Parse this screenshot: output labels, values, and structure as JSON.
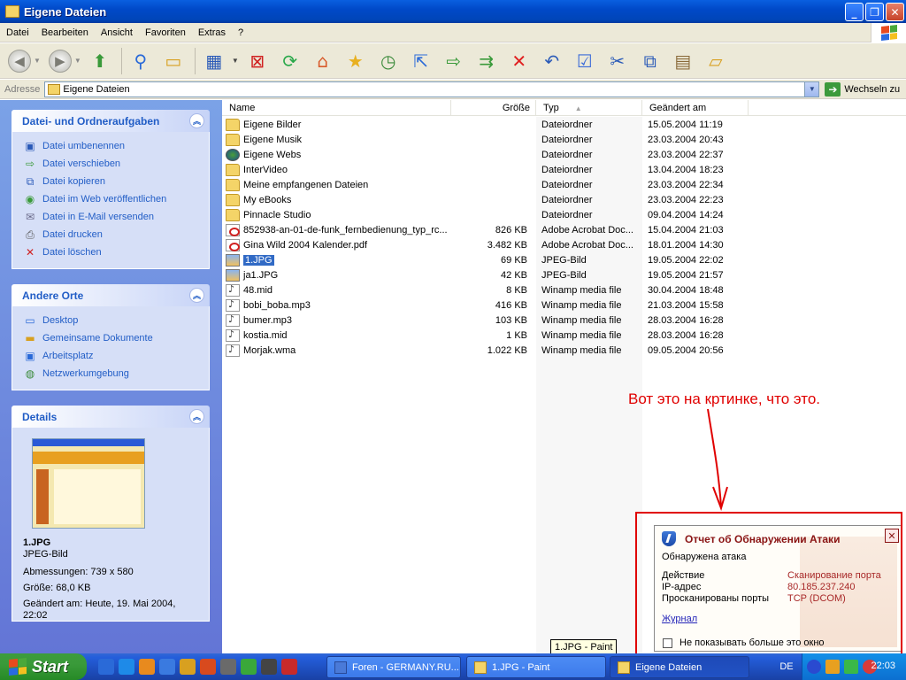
{
  "window": {
    "title": "Eigene Dateien"
  },
  "caption_buttons": {
    "minimize": "_",
    "maximize": "❐",
    "close": "✕"
  },
  "menu": [
    "Datei",
    "Bearbeiten",
    "Ansicht",
    "Favoriten",
    "Extras",
    "?"
  ],
  "toolbar": {
    "icons": [
      "back-icon",
      "forward-icon",
      "up-folder-icon",
      "search-icon",
      "folders-icon",
      "views-icon",
      "delete-file-icon",
      "refresh-icon",
      "home-icon",
      "favorites-star-icon",
      "history-icon",
      "map-drive-icon",
      "move-to-icon",
      "copy-to-icon",
      "delete-icon",
      "undo-icon",
      "properties-icon",
      "cut-icon",
      "copy-icon",
      "paste-icon",
      "folder-options-icon"
    ]
  },
  "address": {
    "label": "Adresse",
    "value": "Eigene Dateien",
    "go_label": "Wechseln zu"
  },
  "taskpane": {
    "file_tasks": {
      "title": "Datei- und Ordneraufgaben",
      "items": [
        {
          "label": "Datei umbenennen",
          "icon": "rename-icon"
        },
        {
          "label": "Datei verschieben",
          "icon": "move-icon"
        },
        {
          "label": "Datei kopieren",
          "icon": "copy-icon"
        },
        {
          "label": "Datei im Web veröffentlichen",
          "icon": "publish-web-icon"
        },
        {
          "label": "Datei in E-Mail versenden",
          "icon": "email-icon"
        },
        {
          "label": "Datei drucken",
          "icon": "print-icon"
        },
        {
          "label": "Datei löschen",
          "icon": "delete-icon"
        }
      ]
    },
    "other_places": {
      "title": "Andere Orte",
      "items": [
        {
          "label": "Desktop",
          "icon": "desktop-icon"
        },
        {
          "label": "Gemeinsame Dokumente",
          "icon": "shared-docs-icon"
        },
        {
          "label": "Arbeitsplatz",
          "icon": "my-computer-icon"
        },
        {
          "label": "Netzwerkumgebung",
          "icon": "network-icon"
        }
      ]
    },
    "details": {
      "title": "Details",
      "name": "1.JPG",
      "type": "JPEG-Bild",
      "dimensions": "Abmessungen: 739 x 580",
      "size": "Größe: 68,0 KB",
      "modified": "Geändert am: Heute, 19. Mai 2004, 22:02"
    }
  },
  "filelist": {
    "columns": {
      "name": "Name",
      "size": "Größe",
      "type": "Typ",
      "modified": "Geändert am"
    },
    "sort_arrow": "▲",
    "rows": [
      {
        "icon": "folder",
        "name": "Eigene Bilder",
        "size": "",
        "type": "Dateiordner",
        "modified": "15.05.2004 11:19"
      },
      {
        "icon": "folder",
        "name": "Eigene Musik",
        "size": "",
        "type": "Dateiordner",
        "modified": "23.03.2004 20:43"
      },
      {
        "icon": "web",
        "name": "Eigene Webs",
        "size": "",
        "type": "Dateiordner",
        "modified": "23.03.2004 22:37"
      },
      {
        "icon": "folder",
        "name": "InterVideo",
        "size": "",
        "type": "Dateiordner",
        "modified": "13.04.2004 18:23"
      },
      {
        "icon": "folder",
        "name": "Meine empfangenen Dateien",
        "size": "",
        "type": "Dateiordner",
        "modified": "23.03.2004 22:34"
      },
      {
        "icon": "folder",
        "name": "My eBooks",
        "size": "",
        "type": "Dateiordner",
        "modified": "23.03.2004 22:23"
      },
      {
        "icon": "folder",
        "name": "Pinnacle Studio",
        "size": "",
        "type": "Dateiordner",
        "modified": "09.04.2004 14:24"
      },
      {
        "icon": "pdf",
        "name": "852938-an-01-de-funk_fernbedienung_typ_rc...",
        "size": "826 KB",
        "type": "Adobe Acrobat Doc...",
        "modified": "15.04.2004 21:03"
      },
      {
        "icon": "pdf",
        "name": "Gina Wild 2004 Kalender.pdf",
        "size": "3.482 KB",
        "type": "Adobe Acrobat Doc...",
        "modified": "18.01.2004 14:30"
      },
      {
        "icon": "jpg",
        "name": "1.JPG",
        "size": "69 KB",
        "type": "JPEG-Bild",
        "modified": "19.05.2004 22:02",
        "selected": true
      },
      {
        "icon": "jpg",
        "name": "ja1.JPG",
        "size": "42 KB",
        "type": "JPEG-Bild",
        "modified": "19.05.2004 21:57"
      },
      {
        "icon": "media",
        "name": "48.mid",
        "size": "8 KB",
        "type": "Winamp media file",
        "modified": "30.04.2004 18:48"
      },
      {
        "icon": "media",
        "name": "bobi_boba.mp3",
        "size": "416 KB",
        "type": "Winamp media file",
        "modified": "21.03.2004 15:58"
      },
      {
        "icon": "media",
        "name": "bumer.mp3",
        "size": "103 KB",
        "type": "Winamp media file",
        "modified": "28.03.2004 16:28"
      },
      {
        "icon": "media",
        "name": "kostia.mid",
        "size": "1 KB",
        "type": "Winamp media file",
        "modified": "28.03.2004 16:28"
      },
      {
        "icon": "media",
        "name": "Morjak.wma",
        "size": "1.022 KB",
        "type": "Winamp media file",
        "modified": "09.05.2004 20:56"
      }
    ]
  },
  "annotation": {
    "text": "Вот это на кртинке, что это.",
    "color": "#e00000"
  },
  "attack_popup": {
    "title": "Отчет об Обнаружении Атаки",
    "subtitle": "Обнаружена атака",
    "fields": [
      {
        "label": "Действие",
        "value": "Сканирование порта"
      },
      {
        "label": "IP-адрес",
        "value": "80.185.237.240"
      },
      {
        "label": "Просканированы порты",
        "value": "TCP (DCOM)"
      }
    ],
    "link": "Журнал",
    "checkbox_label": "Не показывать больше это окно",
    "close": "✕"
  },
  "tooltip": "1.JPG - Paint",
  "taskbar": {
    "start_label": "Start",
    "quicklaunch": [
      {
        "icon": "outlook-icon",
        "color": "#2a6ad8"
      },
      {
        "icon": "internet-explorer-icon",
        "color": "#1e8ae8"
      },
      {
        "icon": "media-player-icon",
        "color": "#e88a1e"
      },
      {
        "icon": "messenger-icon",
        "color": "#3a7ae0"
      },
      {
        "icon": "winamp-icon",
        "color": "#d8a020"
      },
      {
        "icon": "firefox-icon",
        "color": "#d84a1e"
      },
      {
        "icon": "dsl-icon",
        "color": "#6a6a6a"
      },
      {
        "icon": "flower-icon",
        "color": "#3aa83a"
      },
      {
        "icon": "b-icon",
        "color": "#444444"
      },
      {
        "icon": "car-icon",
        "color": "#c82a2a"
      }
    ],
    "buttons": [
      {
        "label": "Foren - GERMANY.RU...",
        "active": false
      },
      {
        "label": "1.JPG - Paint",
        "active": false
      },
      {
        "label": "Eigene Dateien",
        "active": true
      }
    ],
    "language": "DE",
    "clock": "22:03"
  }
}
